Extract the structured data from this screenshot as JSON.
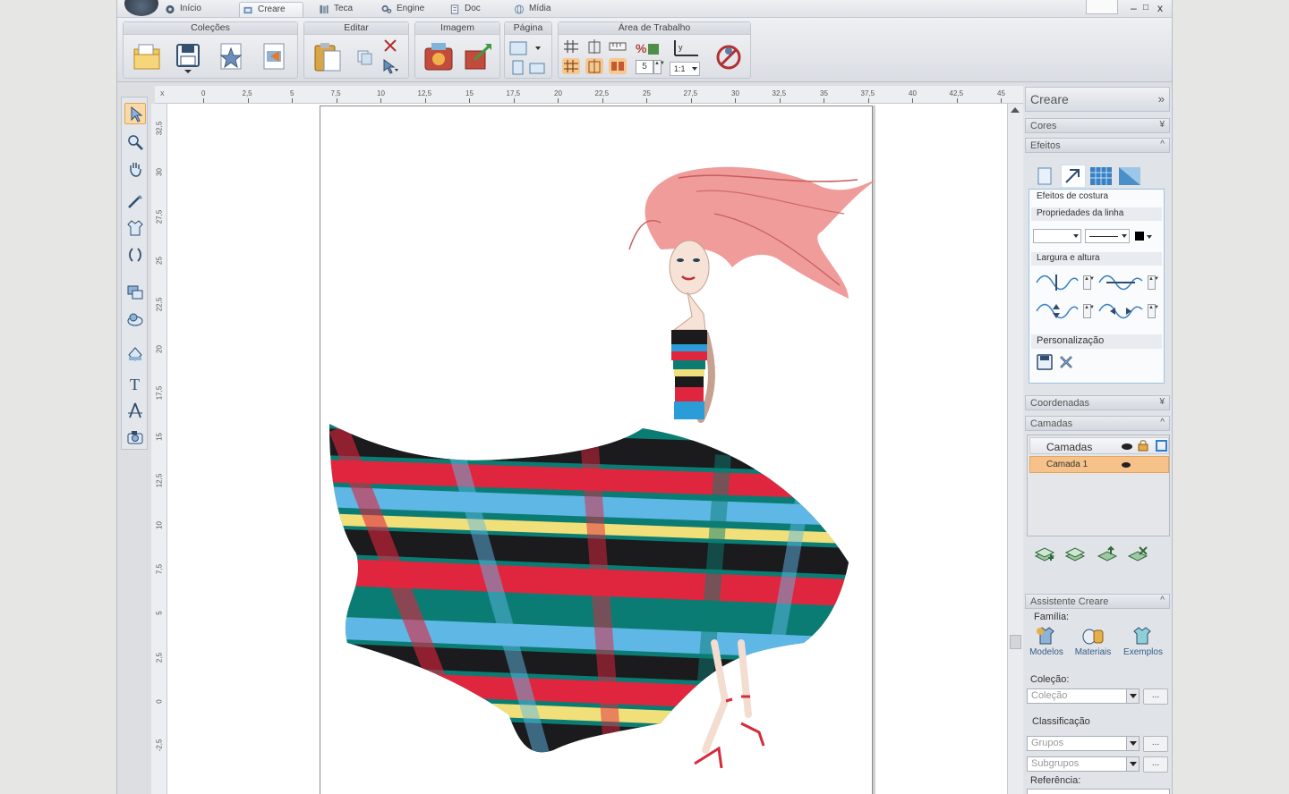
{
  "tabs": [
    {
      "label": "Início",
      "icon": "home-icon"
    },
    {
      "label": "Creare",
      "icon": "creare-icon",
      "active": true
    },
    {
      "label": "Teca",
      "icon": "library-icon"
    },
    {
      "label": "Engine",
      "icon": "gears-icon"
    },
    {
      "label": "Doc",
      "icon": "document-icon"
    },
    {
      "label": "Mídia",
      "icon": "globe-icon"
    }
  ],
  "window_controls": {
    "minimize": "–",
    "maximize": "□",
    "close": "x"
  },
  "ribbon": {
    "groups": [
      {
        "title": "Coleções"
      },
      {
        "title": "Editar"
      },
      {
        "title": "Imagem"
      },
      {
        "title": "Página"
      },
      {
        "title": "Área de Trabalho",
        "spin_value": "5",
        "zoom_value": "1:1"
      }
    ]
  },
  "ruler": {
    "origin_label": "x",
    "h_ticks": [
      "0",
      "2,5",
      "5",
      "7,5",
      "10",
      "12,5",
      "15",
      "17,5",
      "20",
      "22,5",
      "25",
      "27,5",
      "30",
      "32,5",
      "35",
      "37,5",
      "40",
      "42,5",
      "45"
    ],
    "v_ticks": [
      "32,5",
      "30",
      "27,5",
      "25",
      "22,5",
      "20",
      "17,5",
      "15",
      "12,5",
      "10",
      "7,5",
      "5",
      "2,5",
      "0",
      "-2,5"
    ]
  },
  "panel": {
    "title": "Creare",
    "sections": {
      "cores": "Cores",
      "efeitos": "Efeitos",
      "coordenadas": "Coordenadas",
      "camadas": "Camadas",
      "assistente": "Assistente Creare"
    },
    "effects": {
      "seam_effects": "Efeitos de costura",
      "line_props": "Propriedades da linha",
      "width_height": "Largura e altura",
      "personalization": "Personalização"
    },
    "layers": {
      "header": "Camadas",
      "rows": [
        {
          "name": "Camada 1"
        }
      ]
    },
    "assistant": {
      "family_label": "Família:",
      "family_items": [
        {
          "label": "Modelos",
          "icon": "models-icon"
        },
        {
          "label": "Materiais",
          "icon": "materials-icon"
        },
        {
          "label": "Exemplos",
          "icon": "examples-icon"
        }
      ],
      "collection_label": "Coleção:",
      "collection_placeholder": "Coleção",
      "classification_label": "Classificação",
      "groups_placeholder": "Grupos",
      "subgroups_placeholder": "Subgrupos",
      "reference_label": "Referência:",
      "more_button": "..."
    }
  }
}
